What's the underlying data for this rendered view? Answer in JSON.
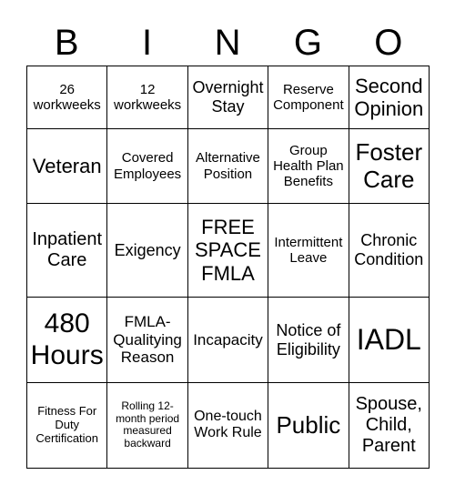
{
  "header": [
    "B",
    "I",
    "N",
    "G",
    "O"
  ],
  "cells": [
    [
      "26 workweeks",
      "12 workweeks",
      "Overnight Stay",
      "Reserve Component",
      "Second Opinion"
    ],
    [
      "Veteran",
      "Covered Employees",
      "Alternative Position",
      "Group Health Plan Benefits",
      "Foster Care"
    ],
    [
      "Inpatient Care",
      "Exigency",
      "FREE SPACE FMLA",
      "Intermittent Leave",
      "Chronic Condition"
    ],
    [
      "480 Hours",
      "FMLA-Qualitying Reason",
      "Incapacity",
      "Notice of Eligibility",
      "IADL"
    ],
    [
      "Fitness For Duty Certification",
      "Rolling 12-month period measured backward",
      "One-touch Work Rule",
      "Public",
      "Spouse, Child, Parent"
    ]
  ]
}
